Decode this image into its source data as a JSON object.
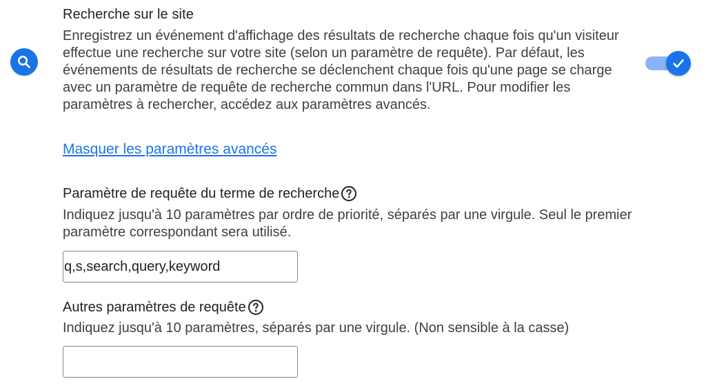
{
  "site_search": {
    "title": "Recherche sur le site",
    "description": "Enregistrez un événement d'affichage des résultats de recherche chaque fois qu'un visiteur effectue une recherche sur votre site (selon un paramètre de requête). Par défaut, les événements de résultats de recherche se déclenchent chaque fois qu'une page se charge avec un paramètre de requête de recherche commun dans l'URL. Pour modifier les paramètres à rechercher, accédez aux paramètres avancés.",
    "icon": "search-icon",
    "toggle_on": true,
    "accent_color": "#1a73e8",
    "toggle_track_color": "#8ab4f8"
  },
  "advanced_link": "Masquer les paramètres avancés",
  "search_term_param": {
    "label": "Paramètre de requête du terme de recherche",
    "help": "Indiquez jusqu'à 10 paramètres par ordre de priorité, séparés par une virgule. Seul le premier paramètre correspondant sera utilisé.",
    "value": "q,s,search,query,keyword"
  },
  "other_params": {
    "label": "Autres paramètres de requête",
    "help": "Indiquez jusqu'à 10 paramètres, séparés par une virgule. (Non sensible à la casse)",
    "value": ""
  }
}
